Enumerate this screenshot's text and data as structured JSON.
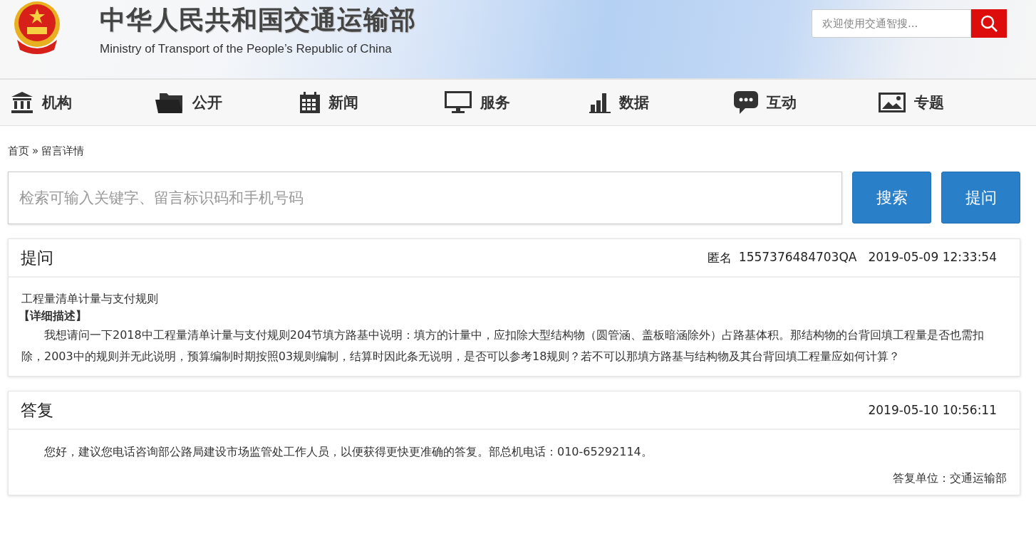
{
  "header": {
    "title_cn": "中华人民共和国交通运输部",
    "title_en": "Ministry of Transport of the People’s Republic of China",
    "search": {
      "placeholder": "欢迎使用交通智搜..."
    }
  },
  "nav": [
    {
      "kind": "institution",
      "label": "机构"
    },
    {
      "kind": "folder",
      "label": "公开"
    },
    {
      "kind": "calendar",
      "label": "新闻"
    },
    {
      "kind": "monitor",
      "label": "服务"
    },
    {
      "kind": "chart",
      "label": "数据"
    },
    {
      "kind": "chat",
      "label": "互动"
    },
    {
      "kind": "picture",
      "label": "专题"
    }
  ],
  "breadcrumb": [
    "首页",
    "»",
    "留言详情"
  ],
  "search": {
    "placeholder": "检索可输入关键字、留言标识码和手机号码",
    "buttons": [
      "搜索",
      "提问"
    ]
  },
  "question": {
    "heading": "提问",
    "author": "匿名",
    "code": "1557376484703QA",
    "time": "2019-05-09 12:33:54",
    "subject": "工程量清单计量与支付规则",
    "detail_label": "【详细描述】",
    "body": "我想请问一下2018中工程量清单计量与支付规则204节填方路基中说明：填方的计量中，应扣除大型结构物（圆管涵、盖板暗涵除外）占路基体积。那结构物的台背回填工程量是否也需扣除，2003中的规则并无此说明，预算编制时期按照03规则编制，结算时因此条无说明，是否可以参考18规则？若不可以那填方路基与结构物及其台背回填工程量应如何计算？"
  },
  "answer": {
    "heading": "答复",
    "time": "2019-05-10 10:56:11",
    "body": "您好，建议您电话咨询部公路局建设市场监管处工作人员，以便获得更快更准确的答复。部总机电话：010-65292114。",
    "unit": "答复单位：交通运输部"
  }
}
